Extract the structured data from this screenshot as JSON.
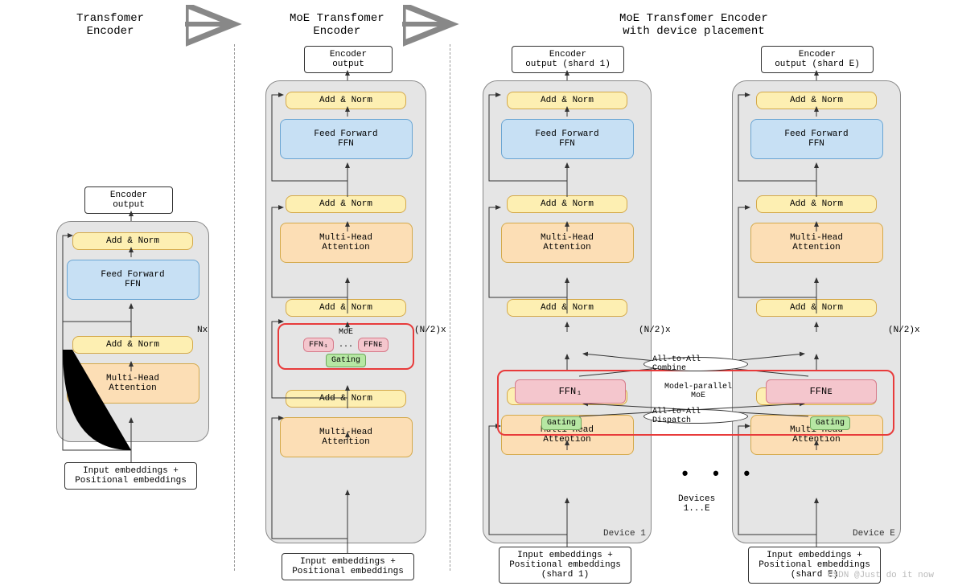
{
  "titles": {
    "t1": "Transfomer\nEncoder",
    "t2": "MoE Transfomer\nEncoder",
    "t3": "MoE Transfomer Encoder\nwith device placement"
  },
  "labels": {
    "encout": "Encoder\noutput",
    "encout1": "Encoder\noutput (shard 1)",
    "encoutE": "Encoder\noutput (shard E)",
    "addnorm": "Add & Norm",
    "ffn": "Feed Forward\nFFN",
    "mha": "Multi-Head\nAttention",
    "input": "Input embeddings +\nPositional embeddings",
    "input1": "Input embeddings +\nPositional embeddings\n(shard 1)",
    "inputE": "Input embeddings +\nPositional embeddings\n(shard E)",
    "nx": "Nx",
    "nx2": "(N/2)x",
    "moe": "MoE",
    "ffn1": "FFN₁",
    "ffnE": "FFNᴇ",
    "gating": "Gating",
    "a2a_c": "All-to-All Combine",
    "a2a_d": "All-to-All Dispatch",
    "mpm": "Model-parallel\nMoE",
    "devices": "Devices\n1...E",
    "dev1": "Device 1",
    "devE": "Device E",
    "dots": "...",
    "bigdots": "• • •"
  },
  "watermark": "CSDN @Just do it now"
}
